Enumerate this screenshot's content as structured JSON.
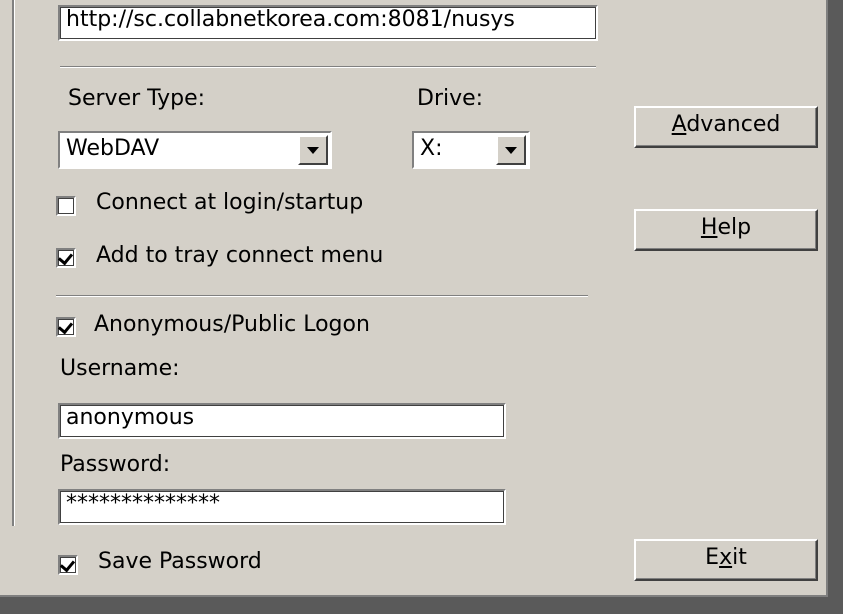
{
  "url": {
    "value": "http://sc.collabnetkorea.com:8081/nusys"
  },
  "server_type": {
    "label": "Server Type:",
    "value": "WebDAV"
  },
  "drive": {
    "label": "Drive:",
    "value": "X:"
  },
  "options": {
    "connect_login": {
      "label": "Connect at login/startup",
      "checked": false
    },
    "tray_menu": {
      "label": "Add to tray connect menu",
      "checked": true
    }
  },
  "logon": {
    "anonymous": {
      "label": "Anonymous/Public Logon",
      "checked": true
    },
    "username_label": "Username:",
    "username_value": "anonymous",
    "password_label": "Password:",
    "password_value": "**************",
    "save_password": {
      "label": "Save Password",
      "checked": true
    }
  },
  "buttons": {
    "advanced": {
      "pre": "",
      "mnemonic": "A",
      "post": "dvanced"
    },
    "help": {
      "pre": "",
      "mnemonic": "H",
      "post": "elp"
    },
    "exit": {
      "pre": "E",
      "mnemonic": "x",
      "post": "it"
    }
  }
}
